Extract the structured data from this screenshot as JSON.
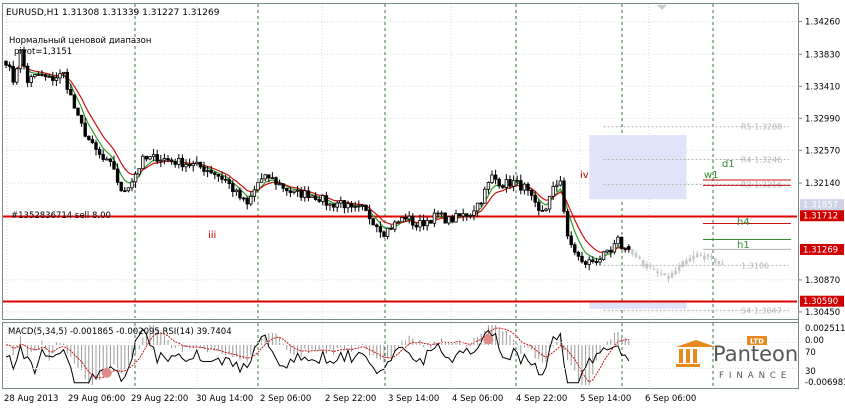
{
  "colors": {
    "background": "#ffffff",
    "grid": "#d8dcdc",
    "session_line": "#2f7a2f",
    "candle": "#000000",
    "ma_fast": "#2e9b2e",
    "ma_slow": "#cc1111",
    "level_red": "#dd0000",
    "zone": "#dfe4fa",
    "macd_hist": "#9a9a9a",
    "macd_signal": "#c81818",
    "rsi_line": "#000000",
    "price_tag": "#d10000",
    "text": "#000000",
    "level_text": "#333333",
    "level_green": "#2f8f2f",
    "level_ghost": "#b4b4b4",
    "forecast": "#c6c6c6",
    "marker": "#e08a8a",
    "panteon_orange": "#e8891f",
    "panteon_grey": "#555555"
  },
  "symbol_header": "EURUSD,H1  1.31308 1.31339 1.31227 1.31269",
  "indicator_name": "Нормальный ценовой диапазон",
  "pivot_label": "pivot=1,3151",
  "order_label": "#1352836714 sell 8.00",
  "wave_labels": {
    "iii": "iii",
    "iv": "iv"
  },
  "level_labels": {
    "d1": "d1",
    "w1": "w1",
    "h4": "h4",
    "h1": "h1"
  },
  "ghost_levels": [
    {
      "text": "R5 1.3288",
      "price": 1.3288
    },
    {
      "text": "R4 1.3246",
      "price": 1.3245
    },
    {
      "text": "R3 1.3216",
      "price": 1.3212
    },
    {
      "text": "1.3106",
      "price": 1.3106
    },
    {
      "text": "S4 1.3047",
      "price": 1.3047
    }
  ],
  "price_scale": {
    "ticks": [
      "1.34260",
      "1.33830",
      "1.33410",
      "1.32990",
      "1.32570",
      "1.32140",
      "1.30870",
      "1.30450"
    ],
    "tick_prices": [
      1.3426,
      1.3383,
      1.3341,
      1.3299,
      1.3257,
      1.3214,
      1.3087,
      1.3045
    ],
    "tags": [
      {
        "text": "1.31857",
        "price": 1.31857,
        "style": "grey"
      },
      {
        "text": "1.31712",
        "price": 1.31712,
        "style": "red"
      },
      {
        "text": "1.31269",
        "price": 1.31269,
        "style": "red"
      },
      {
        "text": "1.30590",
        "price": 1.3059,
        "style": "red"
      }
    ],
    "min": 1.3037,
    "max": 1.3449
  },
  "hlines": [
    {
      "name": "sell-order-line",
      "price": 1.31712
    },
    {
      "name": "support-line",
      "price": 1.3059
    }
  ],
  "subwindow": {
    "header": "MACD(5,34,5) -0.001865 -0.002095  RSI(14) 39.7404",
    "ticks": [
      "0.0025110",
      "0.00",
      "70",
      "30",
      "-0.006983"
    ]
  },
  "time_labels": [
    "28 Aug 2013",
    "29 Aug 06:00",
    "29 Aug 22:00",
    "30 Aug 14:00",
    "2 Sep 06:00",
    "2 Sep 22:00",
    "3 Sep 14:00",
    "4 Sep 06:00",
    "4 Sep 22:00",
    "5 Sep 14:00",
    "6 Sep 06:00"
  ],
  "logo": {
    "name": "Panteon",
    "sub": "FINANCE",
    "badge": "LTD"
  },
  "chart_data": {
    "type": "candlestick",
    "symbol": "EURUSD",
    "timeframe": "H1",
    "ohlc_last": {
      "open": 1.31308,
      "high": 1.31339,
      "low": 1.31227,
      "close": 1.31269
    },
    "close_anchors": [
      [
        0,
        1.3375
      ],
      [
        2,
        1.3349
      ],
      [
        4,
        1.3386
      ],
      [
        6,
        1.3348
      ],
      [
        9,
        1.3356
      ],
      [
        12,
        1.335
      ],
      [
        16,
        1.3357
      ],
      [
        20,
        1.3298
      ],
      [
        24,
        1.3262
      ],
      [
        27,
        1.3244
      ],
      [
        30,
        1.3234
      ],
      [
        32,
        1.32
      ],
      [
        35,
        1.3218
      ],
      [
        38,
        1.3244
      ],
      [
        42,
        1.3248
      ],
      [
        46,
        1.3243
      ],
      [
        50,
        1.324
      ],
      [
        54,
        1.3235
      ],
      [
        57,
        1.323
      ],
      [
        61,
        1.3218
      ],
      [
        64,
        1.32
      ],
      [
        67,
        1.3185
      ],
      [
        70,
        1.3215
      ],
      [
        73,
        1.3222
      ],
      [
        76,
        1.3212
      ],
      [
        80,
        1.32
      ],
      [
        84,
        1.32
      ],
      [
        87,
        1.3195
      ],
      [
        90,
        1.3185
      ],
      [
        93,
        1.319
      ],
      [
        96,
        1.3178
      ],
      [
        99,
        1.318
      ],
      [
        102,
        1.3165
      ],
      [
        105,
        1.315
      ],
      [
        108,
        1.316
      ],
      [
        111,
        1.317
      ],
      [
        114,
        1.3158
      ],
      [
        117,
        1.3165
      ],
      [
        120,
        1.3172
      ],
      [
        123,
        1.3165
      ],
      [
        126,
        1.317
      ],
      [
        129,
        1.3175
      ],
      [
        132,
        1.3193
      ],
      [
        135,
        1.3222
      ],
      [
        138,
        1.3213
      ],
      [
        141,
        1.3215
      ],
      [
        144,
        1.3208
      ],
      [
        146,
        1.3192
      ],
      [
        148,
        1.3175
      ],
      [
        150,
        1.3183
      ],
      [
        152,
        1.3205
      ],
      [
        154,
        1.322
      ],
      [
        155,
        1.3178
      ],
      [
        156,
        1.314
      ],
      [
        158,
        1.3125
      ],
      [
        160,
        1.3108
      ],
      [
        163,
        1.3112
      ],
      [
        166,
        1.3118
      ],
      [
        168,
        1.3122
      ],
      [
        170,
        1.3138
      ],
      [
        172,
        1.3125
      ],
      [
        173,
        1.31269
      ]
    ],
    "forecast_anchors": [
      [
        173,
        1.3127
      ],
      [
        177,
        1.3108
      ],
      [
        181,
        1.3095
      ],
      [
        184,
        1.309
      ],
      [
        188,
        1.3108
      ],
      [
        192,
        1.312
      ],
      [
        196,
        1.3115
      ],
      [
        199,
        1.3105
      ]
    ],
    "zones": [
      {
        "from": 162,
        "to": 189,
        "high": 1.3277,
        "low": 1.3193
      },
      {
        "from": 162,
        "to": 189,
        "high": 1.3059,
        "low": 1.3049
      }
    ],
    "wave_points": [
      {
        "label": "iii",
        "index": 52,
        "price": 1.3168
      },
      {
        "label": "iv",
        "index": 150,
        "price": 1.323
      }
    ],
    "macd_markers": [
      {
        "index": 28,
        "value": -0.0062
      },
      {
        "index": 134,
        "value": 0.0012
      }
    ]
  }
}
